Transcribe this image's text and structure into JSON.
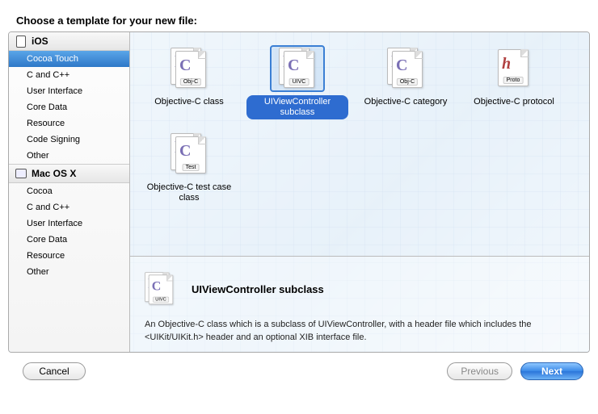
{
  "title": "Choose a template for your new file:",
  "platforms": [
    {
      "name": "iOS",
      "categories": [
        "Cocoa Touch",
        "C and C++",
        "User Interface",
        "Core Data",
        "Resource",
        "Code Signing",
        "Other"
      ],
      "selected_index": 0
    },
    {
      "name": "Mac OS X",
      "categories": [
        "Cocoa",
        "C and C++",
        "User Interface",
        "Core Data",
        "Resource",
        "Other"
      ],
      "selected_index": -1
    }
  ],
  "templates": [
    {
      "label": "Objective-C class",
      "tag": "Obj-C",
      "glyph": "C",
      "glyph_class": "",
      "selected": false
    },
    {
      "label": "UIViewController subclass",
      "tag": "UIVC",
      "glyph": "C",
      "glyph_class": "",
      "selected": true
    },
    {
      "label": "Objective-C category",
      "tag": "Obj-C",
      "glyph": "C",
      "glyph_class": "",
      "selected": false
    },
    {
      "label": "Objective-C protocol",
      "tag": "Proto",
      "glyph": "h",
      "glyph_class": "proto",
      "selected": false
    },
    {
      "label": "Objective-C test case class",
      "tag": "Test",
      "glyph": "C",
      "glyph_class": "",
      "selected": false
    }
  ],
  "detail": {
    "title": "UIViewController subclass",
    "description": "An Objective-C class which is a subclass of UIViewController, with a header file which includes the <UIKit/UIKit.h> header and an optional XIB interface file.",
    "tag": "UIVC",
    "glyph": "C"
  },
  "buttons": {
    "cancel": "Cancel",
    "previous": "Previous",
    "next": "Next"
  }
}
